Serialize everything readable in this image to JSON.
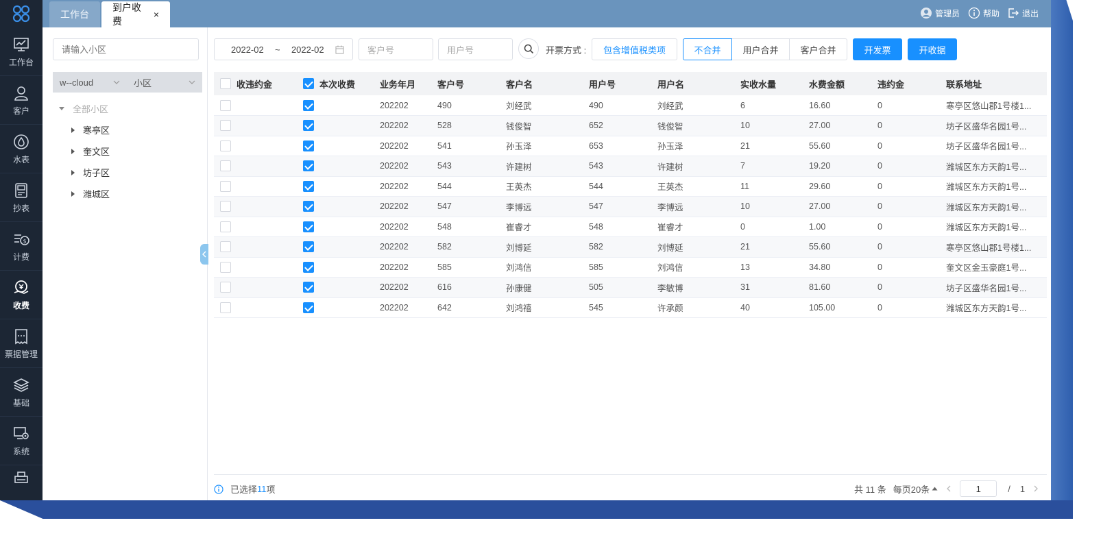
{
  "topbar": {
    "tabs": [
      {
        "label": "工作台"
      },
      {
        "label": "到户收费",
        "close": "×"
      }
    ],
    "admin": "管理员",
    "help": "帮助",
    "logout": "退出"
  },
  "sidebar": {
    "items": [
      {
        "label": "工作台",
        "icon": "monitor-icon"
      },
      {
        "label": "客户",
        "icon": "person-icon"
      },
      {
        "label": "水表",
        "icon": "water-drop-icon"
      },
      {
        "label": "抄表",
        "icon": "meter-icon"
      },
      {
        "label": "计费",
        "icon": "billing-icon"
      },
      {
        "label": "收费",
        "icon": "collect-icon"
      },
      {
        "label": "票据管理",
        "icon": "ticket-icon"
      },
      {
        "label": "基础",
        "icon": "layers-icon"
      },
      {
        "label": "系统",
        "icon": "system-icon"
      }
    ]
  },
  "tree": {
    "search_placeholder": "请输入小区",
    "cloud_select": "w--cloud",
    "community_select": "小区",
    "root": "全部小区",
    "children": [
      "寒亭区",
      "奎文区",
      "坊子区",
      "潍城区"
    ]
  },
  "toolbar": {
    "date_start": "2022-02",
    "date_sep": "~",
    "date_end": "2022-02",
    "customer_placeholder": "客户号",
    "user_placeholder": "用户号",
    "invoice_mode_label": "开票方式 :",
    "vat_button": "包含增值税类项",
    "merge_options": [
      "不合并",
      "用户合并",
      "客户合并"
    ],
    "invoice_button": "开发票",
    "receipt_button": "开收据"
  },
  "table": {
    "headers": {
      "penalty": "收违约金",
      "current": "本次收费",
      "month": "业务年月",
      "customer_no": "客户号",
      "customer_name": "客户名",
      "user_no": "用户号",
      "user_name": "用户名",
      "water": "实收水量",
      "fee": "水费金额",
      "penalty_amt": "违约金",
      "address": "联系地址"
    },
    "rows": [
      {
        "month": "202202",
        "customer_no": "490",
        "customer_name": "刘经武",
        "user_no": "490",
        "user_name": "刘经武",
        "water": "6",
        "fee": "16.60",
        "penalty_amt": "0",
        "address": "寒亭区悠山郡1号楼1..."
      },
      {
        "month": "202202",
        "customer_no": "528",
        "customer_name": "钱俊智",
        "user_no": "652",
        "user_name": "钱俊智",
        "water": "10",
        "fee": "27.00",
        "penalty_amt": "0",
        "address": "坊子区盛华名园1号..."
      },
      {
        "month": "202202",
        "customer_no": "541",
        "customer_name": "孙玉泽",
        "user_no": "653",
        "user_name": "孙玉泽",
        "water": "21",
        "fee": "55.60",
        "penalty_amt": "0",
        "address": "坊子区盛华名园1号..."
      },
      {
        "month": "202202",
        "customer_no": "543",
        "customer_name": "许建树",
        "user_no": "543",
        "user_name": "许建树",
        "water": "7",
        "fee": "19.20",
        "penalty_amt": "0",
        "address": "潍城区东方天韵1号..."
      },
      {
        "month": "202202",
        "customer_no": "544",
        "customer_name": "王英杰",
        "user_no": "544",
        "user_name": "王英杰",
        "water": "11",
        "fee": "29.60",
        "penalty_amt": "0",
        "address": "潍城区东方天韵1号..."
      },
      {
        "month": "202202",
        "customer_no": "547",
        "customer_name": "李博远",
        "user_no": "547",
        "user_name": "李博远",
        "water": "10",
        "fee": "27.00",
        "penalty_amt": "0",
        "address": "潍城区东方天韵1号..."
      },
      {
        "month": "202202",
        "customer_no": "548",
        "customer_name": "崔睿才",
        "user_no": "548",
        "user_name": "崔睿才",
        "water": "0",
        "fee": "1.00",
        "penalty_amt": "0",
        "address": "潍城区东方天韵1号..."
      },
      {
        "month": "202202",
        "customer_no": "582",
        "customer_name": "刘博延",
        "user_no": "582",
        "user_name": "刘博延",
        "water": "21",
        "fee": "55.60",
        "penalty_amt": "0",
        "address": "寒亭区悠山郡1号楼1..."
      },
      {
        "month": "202202",
        "customer_no": "585",
        "customer_name": "刘鸿信",
        "user_no": "585",
        "user_name": "刘鸿信",
        "water": "13",
        "fee": "34.80",
        "penalty_amt": "0",
        "address": "奎文区金玉豪庭1号..."
      },
      {
        "month": "202202",
        "customer_no": "616",
        "customer_name": "孙康健",
        "user_no": "505",
        "user_name": "李敏博",
        "water": "31",
        "fee": "81.60",
        "penalty_amt": "0",
        "address": "坊子区盛华名园1号..."
      },
      {
        "month": "202202",
        "customer_no": "642",
        "customer_name": "刘鸿禧",
        "user_no": "545",
        "user_name": "许承颜",
        "water": "40",
        "fee": "105.00",
        "penalty_amt": "0",
        "address": "潍城区东方天韵1号..."
      }
    ]
  },
  "footer": {
    "selected_prefix": "已选择",
    "selected_count": "11",
    "selected_suffix": "项",
    "total": "共 11 条",
    "page_size": "每页20条",
    "page_current": "1",
    "page_sep": "/",
    "page_total": "1"
  },
  "colors": {
    "primary": "#1890ff",
    "sidebar_bg": "#1c2634",
    "topbar_bg": "#6a94bd"
  }
}
